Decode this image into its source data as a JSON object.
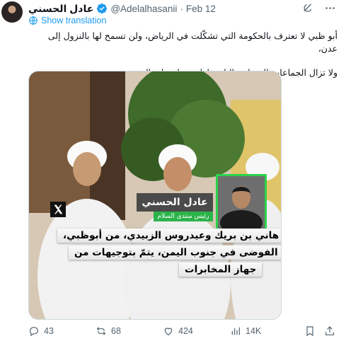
{
  "author": {
    "name": "عادل الحسني",
    "handle": "@Adelalhasanii",
    "separator": "·",
    "date": "Feb 12"
  },
  "translate_label": "Show translation",
  "tweet": {
    "line1": "أبو ظبي لا تعترف بالحكومة التي تشكّلت في الرياض، ولن تسمح لها بالنزول إلى عدن،",
    "line2": "ولا تزال الجماعات المسلحة التابعة لها تسيطر على المدينة."
  },
  "media": {
    "overlay_name": "عادل الحسني",
    "overlay_role": "رئيس منتدى السلام",
    "caption_line1": "تحريض هاني بن بريك وعيدروس الزبيدي، من أبوظبي،",
    "caption_line2": "على الفوضى في جنوب اليمن، يتمّ بتوجيهات من",
    "caption_line3": "جهاز المخابرات"
  },
  "actions": {
    "replies": "43",
    "reposts": "68",
    "likes": "424",
    "views": "14K"
  },
  "colors": {
    "accent": "#1d9bf0",
    "muted": "#536471",
    "overlay_green": "#2bb34a"
  },
  "icons": [
    "verified-badge-icon",
    "grok-icon",
    "more-icon",
    "translate-icon",
    "reply-icon",
    "repost-icon",
    "like-icon",
    "views-icon",
    "bookmark-icon",
    "share-icon",
    "x-logo-icon"
  ]
}
